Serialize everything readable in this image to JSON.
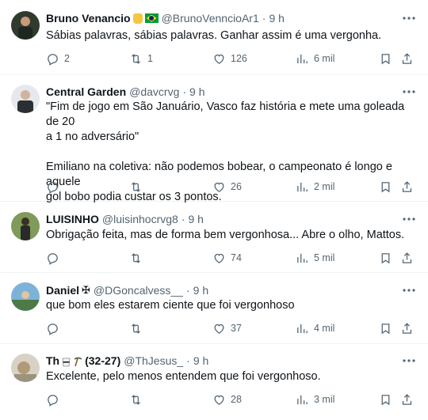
{
  "tweets": [
    {
      "name": "Bruno Venancio",
      "handle": "@BrunoVenncioAr1",
      "time": "9 h",
      "text": [
        "Sábias palavras, sábias palavras. Ganhar assim é uma vergonha."
      ],
      "replies": "2",
      "retweets": "1",
      "likes": "126",
      "views": "6 mil",
      "avatar_color": "#3b4a3a"
    },
    {
      "name": "Central Garden",
      "handle": "@davcrvg",
      "time": "9 h",
      "text": [
        "\"Fim de jogo em São Januário, Vasco faz história e mete uma goleada de 20",
        "a 1 no adversário\"",
        "",
        "Emiliano na coletiva: não podemos bobear, o campeonato é longo e aquele",
        "gol bobo podia custar os 3 pontos."
      ],
      "replies": "",
      "retweets": "",
      "likes": "26",
      "views": "2 mil",
      "avatar_color": "#5a6a7a"
    },
    {
      "name": "LUISINHO",
      "handle": "@luisinhocrvg8",
      "time": "9 h",
      "text": [
        "Obrigação feita, mas de forma bem vergonhosa... Abre o olho, Mattos."
      ],
      "replies": "",
      "retweets": "",
      "likes": "74",
      "views": "5 mil",
      "avatar_color": "#6f8a4e"
    },
    {
      "name": "Daniel",
      "name_suffix": "✠",
      "handle": "@DGoncalvess__",
      "time": "9 h",
      "text": [
        "que bom eles estarem ciente que foi vergonhoso"
      ],
      "replies": "",
      "retweets": "",
      "likes": "37",
      "views": "4 mil",
      "avatar_color": "#5b8fb5"
    },
    {
      "name": "Th",
      "name_suffix": "(32-27)",
      "handle": "@ThJesus_",
      "time": "9 h",
      "text": [
        "Excelente, pelo menos entendem que foi vergonhoso."
      ],
      "replies": "",
      "retweets": "",
      "likes": "28",
      "views": "3 mil",
      "avatar_color": "#b7ad9b"
    }
  ],
  "dot": "·",
  "icons": {
    "reply": "reply-icon",
    "retweet": "retweet-icon",
    "like": "heart-icon",
    "views": "views-icon",
    "bookmark": "bookmark-icon",
    "share": "share-icon",
    "more": "more-icon"
  },
  "colors": {
    "text": "#0f1419",
    "secondary": "#536471",
    "border": "#eff3f4"
  }
}
